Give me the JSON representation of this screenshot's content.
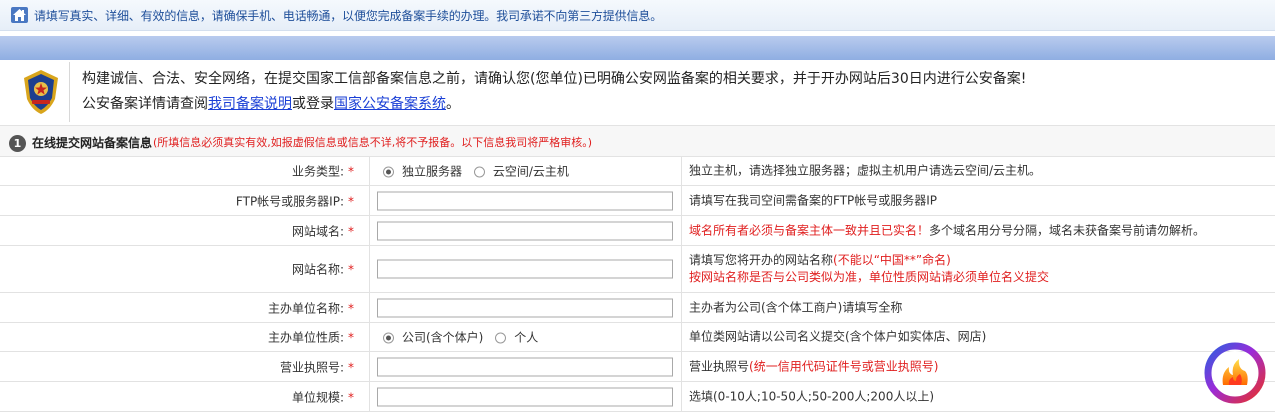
{
  "notice_bar": {
    "icon": "home-icon",
    "text": "请填写真实、详细、有效的信息，请确保手机、电话畅通，以便您完成备案手续的办理。我司承诺不向第三方提供信息。"
  },
  "police_notice": {
    "icon": "police-badge-icon",
    "line1": "构建诚信、合法、安全网络，在提交国家工信部备案信息之前，请确认您(您单位)已明确公安网监备案的相关要求，并于开办网站后30日内进行公安备案!",
    "line2_prefix": "公安备案详情请查阅",
    "link1": "我司备案说明",
    "line2_mid": "或登录",
    "link2": "国家公安备案系统",
    "line2_suffix": "。"
  },
  "section": {
    "number": "1",
    "title": "在线提交网站备案信息",
    "note": "(所填信息必须真实有效,如报虚假信息或信息不详,将不予报备。以下信息我司将严格审核。)"
  },
  "form": {
    "star": "*",
    "business_type": {
      "label": "业务类型:",
      "option1": "独立服务器",
      "option2": "云空间/云主机",
      "hint": "独立主机，请选择独立服务器；虚拟主机用户请选云空间/云主机。"
    },
    "ftp": {
      "label": "FTP帐号或服务器IP:",
      "value": "",
      "hint": "请填写在我司空间需备案的FTP帐号或服务器IP"
    },
    "domain": {
      "label": "网站域名:",
      "value": "",
      "hint_red": "域名所有者必须与备案主体一致并且已实名！",
      "hint": "多个域名用分号分隔，域名未获备案号前请勿解析。"
    },
    "site_name": {
      "label": "网站名称:",
      "value": "",
      "hint_line1": "请填写您将开办的网站名称",
      "hint_line1_red": "(不能以“中国**”命名)",
      "hint_line2_red": "按网站名称是否与公司类似为准，单位性质网站请必须单位名义提交"
    },
    "sponsor": {
      "label": "主办单位名称:",
      "value": "",
      "hint": "主办者为公司(含个体工商户)请填写全称"
    },
    "sponsor_type": {
      "label": "主办单位性质:",
      "option1": "公司(含个体户)",
      "option2": "个人",
      "hint": "单位类网站请以公司名义提交(含个体户如实体店、网店)"
    },
    "license": {
      "label": "营业执照号:",
      "value": "",
      "hint": "营业执照号",
      "hint_red": "(统一信用代码证件号或营业执照号)"
    },
    "scale": {
      "label": "单位规模:",
      "value": "",
      "hint": "选填(0-10人;10-50人;50-200人;200人以上)"
    }
  },
  "floating_button": {
    "icon": "fire-logo-icon"
  }
}
